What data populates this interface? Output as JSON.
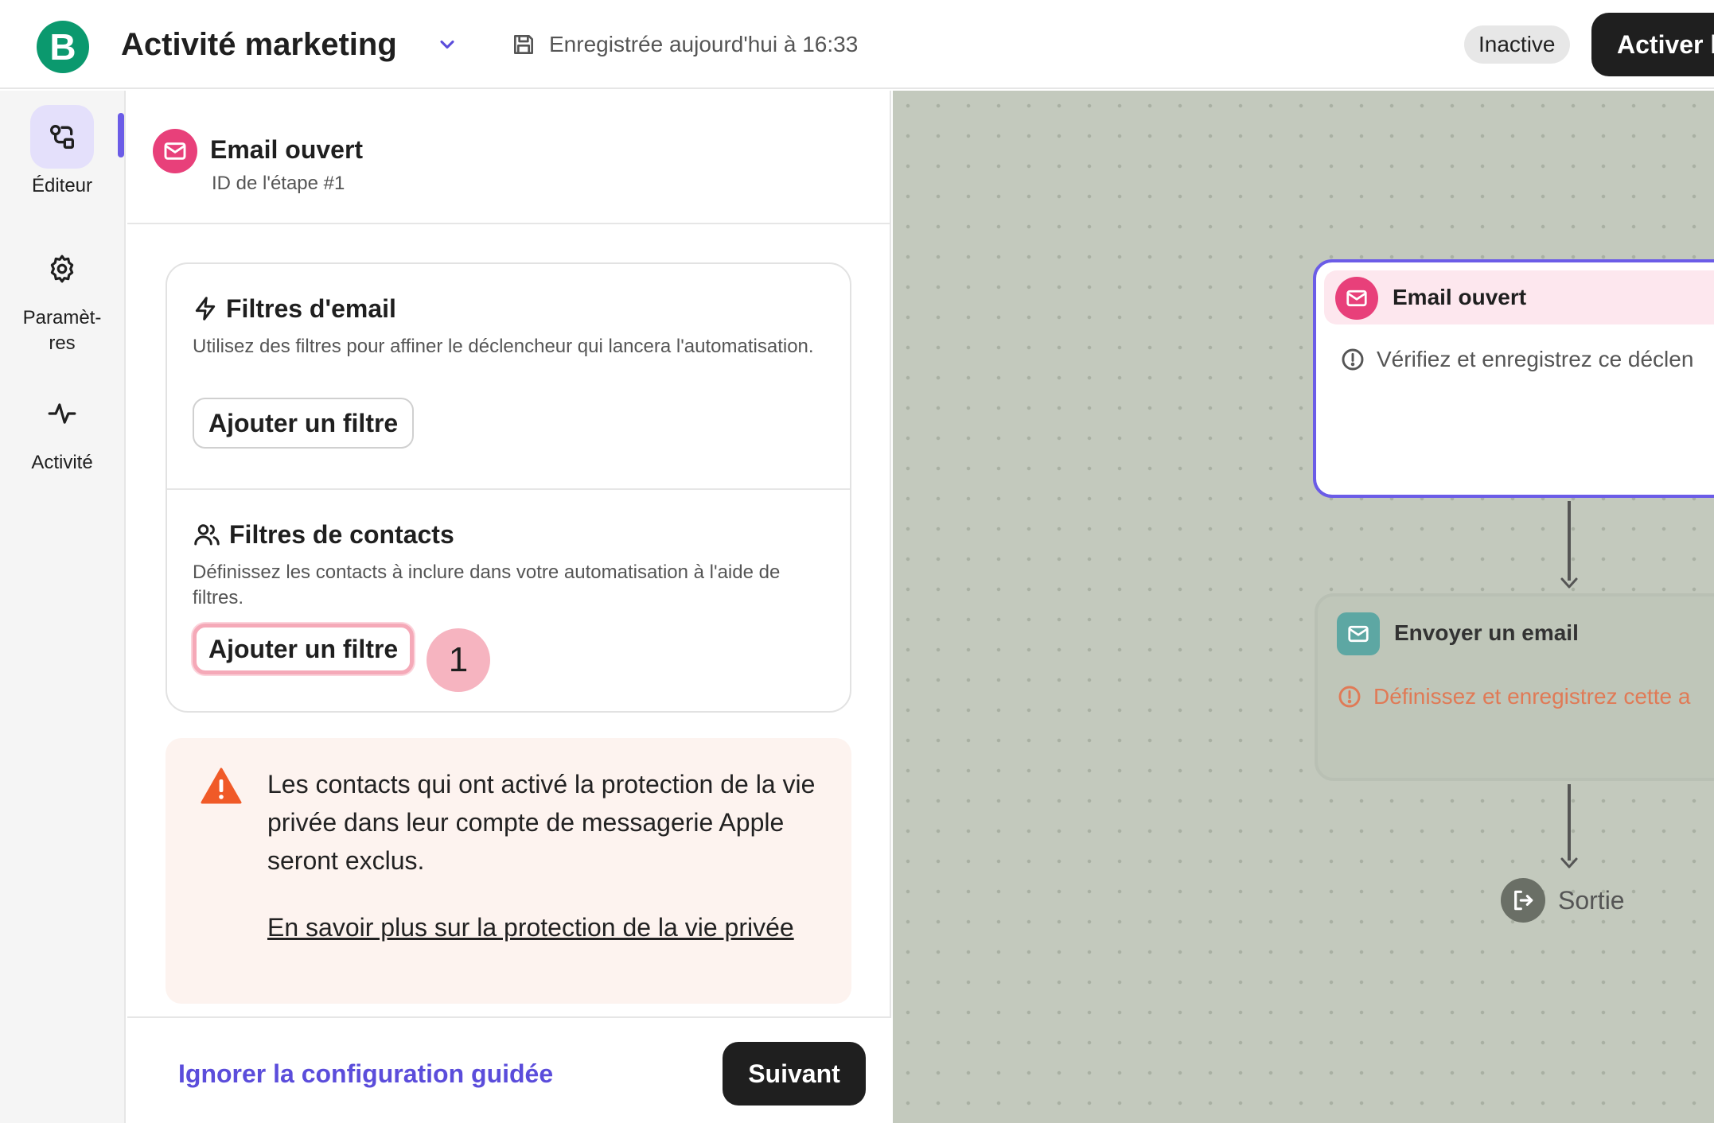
{
  "header": {
    "logo_letter": "B",
    "title": "Activité marketing",
    "save_status": "Enregistrée aujourd'hui à 16:33",
    "status_badge": "Inactive",
    "activate_label": "Activer l"
  },
  "sidebar": {
    "items": [
      {
        "label": "Éditeur",
        "icon": "editor-icon",
        "active": true
      },
      {
        "label": "Paramèt-res",
        "label_line1": "Paramèt-",
        "label_line2": "res",
        "icon": "gear-icon",
        "active": false
      },
      {
        "label": "Activité",
        "icon": "activity-icon",
        "active": false
      }
    ]
  },
  "panel": {
    "step_title": "Email ouvert",
    "step_id": "ID de l'étape #1",
    "email_filters": {
      "title": "Filtres d'email",
      "description": "Utilisez des filtres pour affiner le déclencheur qui lancera l'automatisation.",
      "button_label": "Ajouter un filtre"
    },
    "contact_filters": {
      "title": "Filtres de contacts",
      "description": "Définissez les contacts à inclure dans votre automatisation à l'aide de filtres.",
      "button_label": "Ajouter un filtre"
    },
    "step_marker": "1",
    "warning": {
      "text": "Les contacts qui ont activé la protection de la vie privée dans leur compte de messagerie Apple seront exclus.",
      "link": "En savoir plus sur la protection de la vie privée"
    },
    "footer": {
      "skip_label": "Ignorer la configuration guidée",
      "next_label": "Suivant"
    }
  },
  "canvas": {
    "trigger_node": {
      "title": "Email ouvert",
      "message": "Vérifiez et enregistrez ce déclen"
    },
    "action_node": {
      "title": "Envoyer un email",
      "message": "Définissez et enregistrez cette a"
    },
    "exit_label": "Sortie"
  },
  "colors": {
    "brand": "#0b996e",
    "accent": "#6b5ce7",
    "email_pink": "#e8407a",
    "warning_orange": "#f05a28",
    "canvas_bg": "#c3c9bd"
  }
}
